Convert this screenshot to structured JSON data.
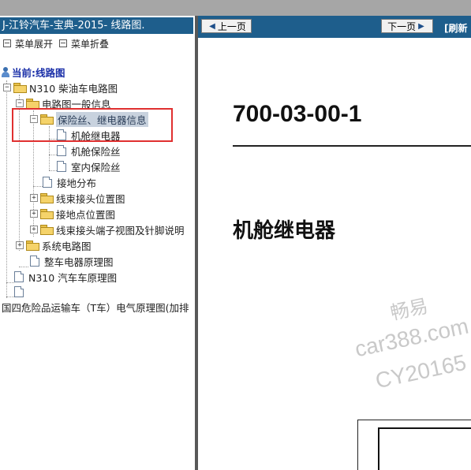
{
  "left_pane": {
    "title": "J-江铃汽车-宝典-2015- 线路图.",
    "menu": {
      "expand": "菜单展开",
      "collapse": "菜单折叠"
    },
    "current": "当前:线路图",
    "tree": [
      {
        "label": "N310 柴油车电路图"
      },
      {
        "label": "电路图一般信息"
      },
      {
        "label": "保险丝、继电器信息",
        "selected": true
      },
      {
        "label": "机舱继电器"
      },
      {
        "label": "机舱保险丝"
      },
      {
        "label": "室内保险丝"
      },
      {
        "label": "接地分布"
      },
      {
        "label": "线束接头位置图"
      },
      {
        "label": "接地点位置图"
      },
      {
        "label": "线束接头端子视图及针脚说明"
      },
      {
        "label": "系统电路图"
      },
      {
        "label": "整车电器原理图"
      },
      {
        "label": "N310 汽车车原理图"
      },
      {
        "label": ""
      },
      {
        "label": "国四危险品运输车（T车）电气原理图(加排"
      }
    ]
  },
  "right_pane": {
    "prev": "上一页",
    "next": "下一页",
    "refresh": "[刷新",
    "doc_code": "700-03-00-1",
    "doc_heading": "机舱继电器",
    "watermark": [
      "畅易",
      "car388.com",
      "CY20165"
    ]
  },
  "colors": {
    "title_bar": "#1e5e8c",
    "highlight": "#e03030",
    "selected_bg": "#c8d2de"
  }
}
